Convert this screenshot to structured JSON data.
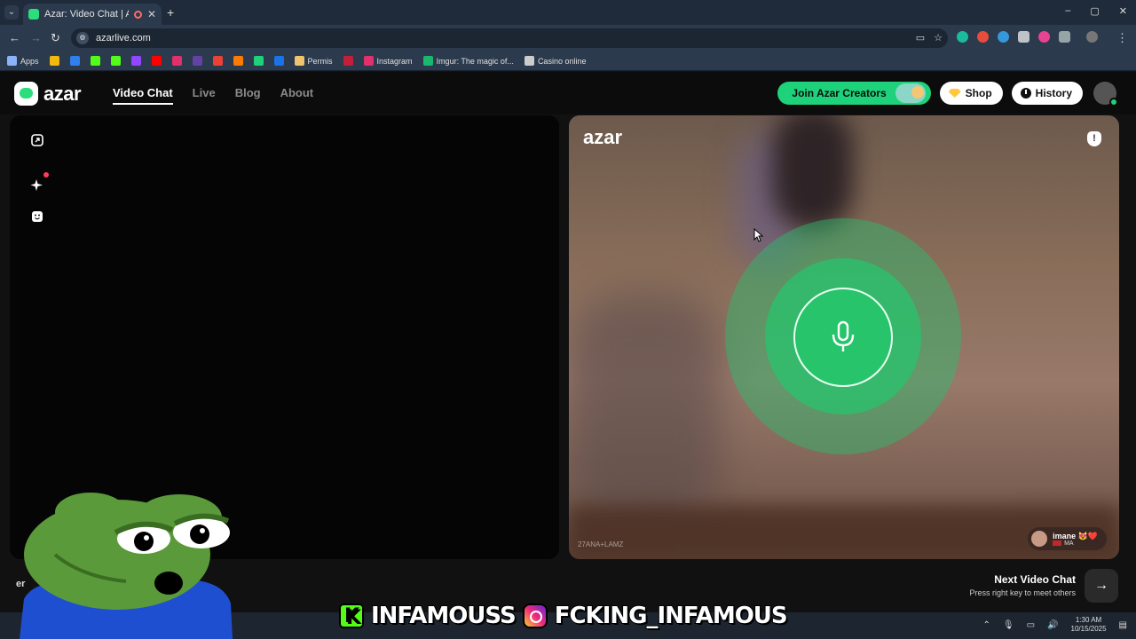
{
  "browser": {
    "tab_title": "Azar: Video Chat | Alternati",
    "tab_close": "✕",
    "new_tab": "+",
    "url": "azarlive.com",
    "window_controls": [
      "–",
      "▢",
      "✕"
    ],
    "bookmarks": [
      {
        "label": "Apps",
        "color": "#8ab4f8"
      },
      {
        "label": "",
        "color": "#f0b90b"
      },
      {
        "label": "",
        "color": "#2f80ed"
      },
      {
        "label": "",
        "color": "#53fc18"
      },
      {
        "label": "",
        "color": "#53fc18"
      },
      {
        "label": "",
        "color": "#9146ff"
      },
      {
        "label": "",
        "color": "#ff0000"
      },
      {
        "label": "",
        "color": "#e1306c"
      },
      {
        "label": "",
        "color": "#6441a5"
      },
      {
        "label": "",
        "color": "#ea4335"
      },
      {
        "label": "",
        "color": "#ff7a00"
      },
      {
        "label": "",
        "color": "#1ed27b"
      },
      {
        "label": "",
        "color": "#1a73e8"
      },
      {
        "label": "Permis",
        "color": "#f0c36d"
      },
      {
        "label": "",
        "color": "#c41e3a"
      },
      {
        "label": "Instagram",
        "color": "#e1306c"
      },
      {
        "label": "Imgur: The magic of...",
        "color": "#1bb76e"
      },
      {
        "label": "Casino online",
        "color": "#cccccc"
      }
    ]
  },
  "header": {
    "logo_text": "azar",
    "nav": [
      "Video Chat",
      "Live",
      "Blog",
      "About"
    ],
    "creators_label": "Join Azar Creators",
    "shop_label": "Shop",
    "history_label": "History"
  },
  "video": {
    "remote_logo": "azar",
    "report_symbol": "!",
    "watermark": "27ANA+LAMZ",
    "peer_name": "imane 😻❤️",
    "peer_country": "MA",
    "left_hint": "er"
  },
  "next": {
    "title": "Next Video Chat",
    "subtitle": "Press right key to meet others",
    "arrow": "→"
  },
  "overlay": {
    "kick_name": "INFAMOUSS",
    "ig_name": "FCKING_INFAMOUS"
  },
  "taskbar": {
    "time": "1:30 AM",
    "date": "10/15/2025"
  },
  "colors": {
    "accent_green": "#1ed27b",
    "kick_green": "#53fc18"
  }
}
